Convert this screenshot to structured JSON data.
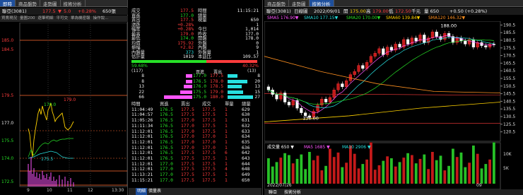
{
  "left_tabs": [
    "即時",
    "商品盤勢",
    "走勢圖",
    "技術分析"
  ],
  "left_header": {
    "name": "聯亞(3081)",
    "price": "177.5",
    "arrow": "▼",
    "change": "5.0",
    "pct": "+0.28%",
    "vol": "650張"
  },
  "left_toolbar": [
    "買賣現況",
    "量圖200",
    "逐筆明細",
    "平可交",
    "單為機密報",
    "操作說..."
  ],
  "left_yaxis": [
    "185.0",
    "184.5",
    "179.5",
    "177.0",
    "175.5",
    "174.0",
    "172.5"
  ],
  "left_xaxis": [
    "9",
    "10",
    "11",
    "12",
    "13:30"
  ],
  "left_annot": {
    "hi": "179.0",
    "lo": "175.5",
    "mid": "170.0"
  },
  "left_status": [
    "明細",
    "價量表"
  ],
  "info": [
    {
      "l": "成交",
      "v": "177.5",
      "l2": "時間",
      "v2": "11:15:21"
    },
    {
      "l": "買進",
      "v": "177.0",
      "l2": "總量",
      "v2": ""
    },
    {
      "l": "賣出",
      "v": "177.5",
      "l2": "現量",
      "v2": "650"
    },
    {
      "l": "漲跌",
      "v": "+0.28%",
      "l2": "",
      "v2": "1"
    },
    {
      "l": "幅度",
      "v": "+0.28%",
      "l2": "今日",
      "v2": "1,014"
    },
    {
      "l": "最高",
      "v": "179.0",
      "l2": "昨收",
      "v2": "177.0"
    },
    {
      "l": "最低",
      "v": "174.0",
      "l2": "開盤",
      "v2": "178.0"
    },
    {
      "l": "均價",
      "v": "175.92",
      "l2": "外盤",
      "v2": "0"
    },
    {
      "l": "振幅",
      "v": "+2.82",
      "l2": "內盤",
      "v2": "9"
    },
    {
      "l": "內盤量",
      "v": "373",
      "l2": "外盤量",
      "v2": "1"
    },
    {
      "l": "估計量",
      "v": "1019",
      "l2": "本益比",
      "v2": "109.57"
    }
  ],
  "ratio": {
    "buy": "59.68%",
    "sell": "40.32%"
  },
  "book_header": {
    "left": "(117)",
    "bid": "買進",
    "ask": "賣出",
    "right": "(13)"
  },
  "book": [
    {
      "bv": "8",
      "bp": "177.0",
      "ap": "177.5",
      "av": "8"
    },
    {
      "bv": "8",
      "bp": "176.5",
      "ap": "178.0",
      "av": "20"
    },
    {
      "bv": "13",
      "bp": "176.0",
      "ap": "178.5",
      "av": "13"
    },
    {
      "bv": "22",
      "bp": "175.5",
      "ap": "179.0",
      "av": "15"
    },
    {
      "bv": "66",
      "bp": "175.0",
      "ap": "180.0",
      "av": "27"
    }
  ],
  "tick_header": [
    "時間",
    "買進",
    "賣出",
    "成交",
    "單量",
    "總量"
  ],
  "ticks": [
    [
      "11:04:49",
      "176.5",
      "177.5",
      "177.5",
      "1",
      "629"
    ],
    [
      "11:04:57",
      "176.5",
      "177.5",
      "177.5",
      "1",
      "630"
    ],
    [
      "11:05:26",
      "176.5",
      "177.0",
      "177.5",
      "1",
      "631"
    ],
    [
      "11:11:34",
      "176.5",
      "177.0",
      "177.5",
      "1",
      "632"
    ],
    [
      "11:12:01",
      "176.5",
      "177.0",
      "177.5",
      "1",
      "633"
    ],
    [
      "11:12:01",
      "176.5",
      "177.0",
      "177.0",
      "1",
      "634"
    ],
    [
      "11:12:01",
      "176.5",
      "177.0",
      "177.0",
      "1",
      "635"
    ],
    [
      "11:12:01",
      "176.5",
      "177.0",
      "177.0",
      "1",
      "636"
    ],
    [
      "11:12:01",
      "176.5",
      "177.5",
      "177.5",
      "6",
      "642"
    ],
    [
      "11:12:01",
      "176.5",
      "177.5",
      "177.5",
      "1",
      "643"
    ],
    [
      "11:12:01",
      "177.0",
      "177.5",
      "177.5",
      "1",
      "644"
    ],
    [
      "11:12:01",
      "177.0",
      "177.5",
      "177.5",
      "4",
      "648"
    ],
    [
      "11:13:21",
      "177.0",
      "177.5",
      "177.5",
      "1",
      "649"
    ],
    [
      "11:15:21",
      "177.0",
      "177.5",
      "177.5",
      "1",
      "650"
    ]
  ],
  "right_tabs": [
    "聯亞(3081)",
    "日線圖"
  ],
  "right_header": {
    "date": "2022/09/01",
    "open_l": "開",
    "open": "175.00",
    "high_l": "高",
    "high": "179.00",
    "low_l": "低",
    "low": "172.50",
    "unit": "千元",
    "vol": "量 650",
    "ch": "+0.50 (+0.28%)"
  },
  "ma_legend": [
    "SMA5 176.90▼",
    "SMA10 177.15▼",
    "SMA20 170.00▼",
    "SMA60 139.84▼",
    "SMA120 146.32▼"
  ],
  "right_yaxis": [
    "190.5",
    "185.5",
    "180.5",
    "175.5",
    "170.5",
    "165.5",
    "160.5",
    "155.5",
    "150.5",
    "145.5",
    "140.5",
    "135.5",
    "130.5",
    "125.5",
    "120.5"
  ],
  "annot_high": "188.00",
  "annot_low": "130.00",
  "vol_legend": {
    "v": "成交量 650 ▼",
    "ma5": "MA5 1685 ▼",
    "ma10": "MA10 2906 ▼"
  },
  "vol_axis": [
    "10K",
    "5K"
  ],
  "date_axis": [
    "2022/07/26",
    "09"
  ],
  "right_status": [
    "聯亞",
    "技術分析"
  ],
  "colors": {
    "up": "#ff3c3c",
    "down": "#ffffff",
    "sma5": "#ff55ff",
    "sma10": "#27e0e0",
    "sma20": "#27e027",
    "sma60": "#ffd200",
    "sma120": "#ff9020"
  }
}
